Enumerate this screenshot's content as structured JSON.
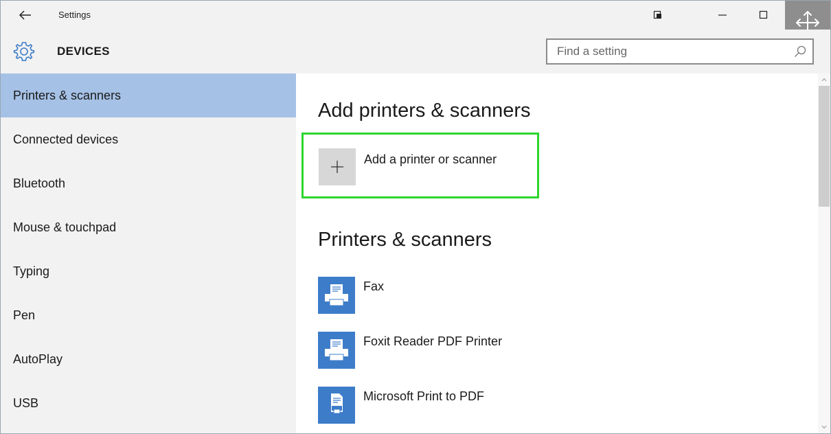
{
  "window": {
    "title": "Settings"
  },
  "header": {
    "section_title": "DEVICES",
    "search_placeholder": "Find a setting"
  },
  "sidebar": {
    "items": [
      {
        "label": "Printers & scanners",
        "active": true
      },
      {
        "label": "Connected devices",
        "active": false
      },
      {
        "label": "Bluetooth",
        "active": false
      },
      {
        "label": "Mouse & touchpad",
        "active": false
      },
      {
        "label": "Typing",
        "active": false
      },
      {
        "label": "Pen",
        "active": false
      },
      {
        "label": "AutoPlay",
        "active": false
      },
      {
        "label": "USB",
        "active": false
      }
    ]
  },
  "main": {
    "add_heading": "Add printers & scanners",
    "add_button_label": "Add a printer or scanner",
    "list_heading": "Printers & scanners",
    "printers": [
      {
        "name": "Fax",
        "icon": "printer-icon"
      },
      {
        "name": "Foxit Reader PDF Printer",
        "icon": "printer-icon"
      },
      {
        "name": "Microsoft Print to PDF",
        "icon": "pdf-printer-icon"
      }
    ]
  },
  "colors": {
    "accent_selected": "#a5c1e6",
    "highlight_border": "#2cd62c",
    "printer_tile": "#3d7cc9",
    "chrome": "#f2f2f2"
  }
}
